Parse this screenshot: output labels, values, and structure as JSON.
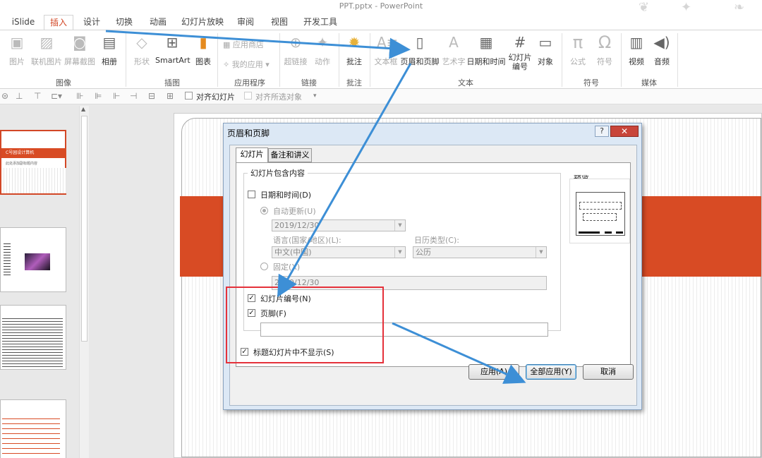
{
  "window": {
    "title": "PPT.pptx - PowerPoint"
  },
  "tabs": [
    "iSlide",
    "插入",
    "设计",
    "切换",
    "动画",
    "幻灯片放映",
    "审阅",
    "视图",
    "开发工具"
  ],
  "ribbon": {
    "buttons": {
      "picture": "图片",
      "online_picture": "联机图片",
      "screenshot": "屏幕截图",
      "album": "相册",
      "shapes": "形状",
      "smartart": "SmartArt",
      "chart": "图表",
      "store": "应用商店",
      "my_apps": "我的应用",
      "hyperlink": "超链接",
      "action": "动作",
      "comment": "批注",
      "textbox": "文本框",
      "header_footer": "页眉和页脚",
      "wordart": "艺术字",
      "datetime": "日期和时间",
      "slide_number": "幻灯片\n编号",
      "object": "对象",
      "equation": "公式",
      "symbol": "符号",
      "video": "视频",
      "audio": "音频"
    },
    "groups": {
      "images": "图像",
      "illustrations": "插图",
      "apps": "应用程序",
      "links": "链接",
      "comments": "批注",
      "text": "文本",
      "symbols": "符号",
      "media": "媒体"
    }
  },
  "qat": {
    "align_slide": "对齐幻灯片",
    "align_selected": "对齐所选对象"
  },
  "thumbnails": {
    "slide1_title": "C号园设计算机",
    "slide1_sub": "此处添加副标题内容"
  },
  "dialog": {
    "title": "页眉和页脚",
    "help": "?",
    "close": "✕",
    "tabs": [
      "幻灯片",
      "备注和讲义"
    ],
    "fieldset_legend": "幻灯片包含内容",
    "datetime_label": "日期和时间(D)",
    "datetime_checked": false,
    "auto_update_label": "自动更新(U)",
    "auto_update_value": "2019/12/30",
    "language_label": "语言(国家/地区)(L):",
    "language_value": "中文(中国)",
    "calendar_label": "日历类型(C):",
    "calendar_value": "公历",
    "fixed_label": "固定(X)",
    "fixed_value": "2019/12/30",
    "slide_number_label": "幻灯片编号(N)",
    "slide_number_checked": true,
    "footer_label": "页脚(F)",
    "footer_checked": true,
    "footer_value": "",
    "no_title_label": "标题幻灯片中不显示(S)",
    "no_title_checked": true,
    "preview_label": "预览",
    "apply_button": "应用(A)",
    "apply_all_button": "全部应用(Y)",
    "cancel_button": "取消"
  },
  "colors": {
    "accent": "#d24726",
    "highlight_box": "#e5313a",
    "arrow": "#3d8fd6"
  }
}
